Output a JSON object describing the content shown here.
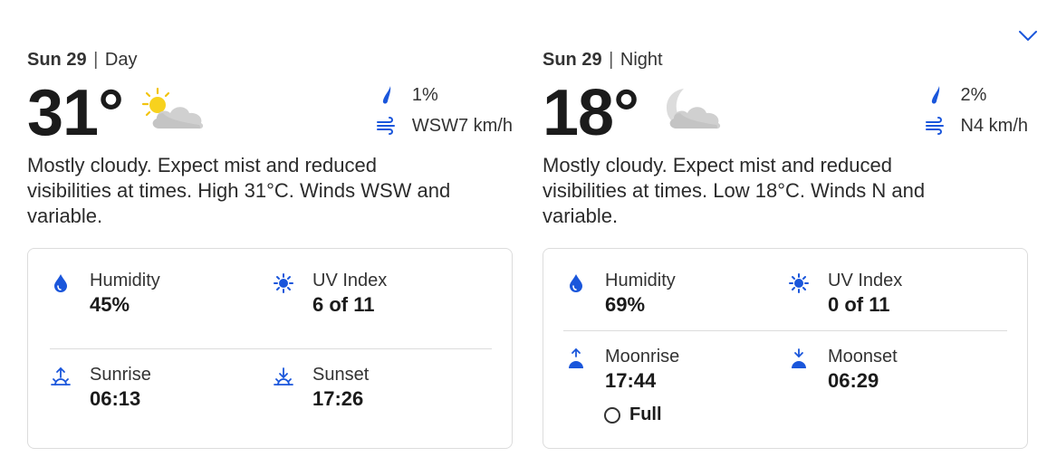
{
  "day": {
    "date": "Sun 29",
    "period": "Day",
    "temperature": "31°",
    "weather_icon": "partly-sunny-cloudy-icon",
    "precipitation": "1%",
    "wind": "WSW7 km/h",
    "summary": "Mostly cloudy. Expect mist and reduced visibilities at times. High 31°C. Winds WSW and variable.",
    "details": {
      "humidity_label": "Humidity",
      "humidity_value": "45%",
      "uv_label": "UV Index",
      "uv_value": "6 of 11",
      "sunrise_label": "Sunrise",
      "sunrise_value": "06:13",
      "sunset_label": "Sunset",
      "sunset_value": "17:26"
    }
  },
  "night": {
    "date": "Sun 29",
    "period": "Night",
    "temperature": "18°",
    "weather_icon": "moon-cloudy-icon",
    "precipitation": "2%",
    "wind": "N4 km/h",
    "summary": "Mostly cloudy. Expect mist and reduced visibilities at times. Low 18°C. Winds N and variable.",
    "details": {
      "humidity_label": "Humidity",
      "humidity_value": "69%",
      "uv_label": "UV Index",
      "uv_value": "0 of 11",
      "moonrise_label": "Moonrise",
      "moonrise_value": "17:44",
      "moonset_label": "Moonset",
      "moonset_value": "06:29",
      "moon_phase": "Full"
    }
  },
  "colors": {
    "accent": "#1a56db",
    "text": "#1b1b1b",
    "border": "#dcdcdc"
  }
}
